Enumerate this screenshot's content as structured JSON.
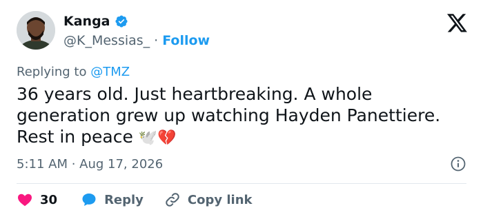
{
  "author": {
    "name": "Kanga",
    "handle": "@K_Messias_",
    "separator": "·",
    "follow_label": "Follow"
  },
  "reply_context": {
    "prefix": "Replying to ",
    "mention": "@TMZ"
  },
  "tweet": {
    "text": "36 years old. Just heartbreaking. A whole generation grew up watching Hayden Panettiere. Rest in peace",
    "emojis": "🕊️💔",
    "timestamp": "5:11 AM · Aug 17, 2026"
  },
  "actions": {
    "like_count": "30",
    "reply_label": "Reply",
    "copy_link_label": "Copy link"
  },
  "icons": {
    "brand": "x-logo",
    "verified": "verified-badge-icon",
    "like": "heart-icon",
    "reply": "speech-bubble-icon",
    "copy": "link-icon",
    "info": "info-icon"
  },
  "colors": {
    "accent": "#1d9bf0",
    "like": "#f91880",
    "text": "#0f1419",
    "muted": "#536471"
  }
}
